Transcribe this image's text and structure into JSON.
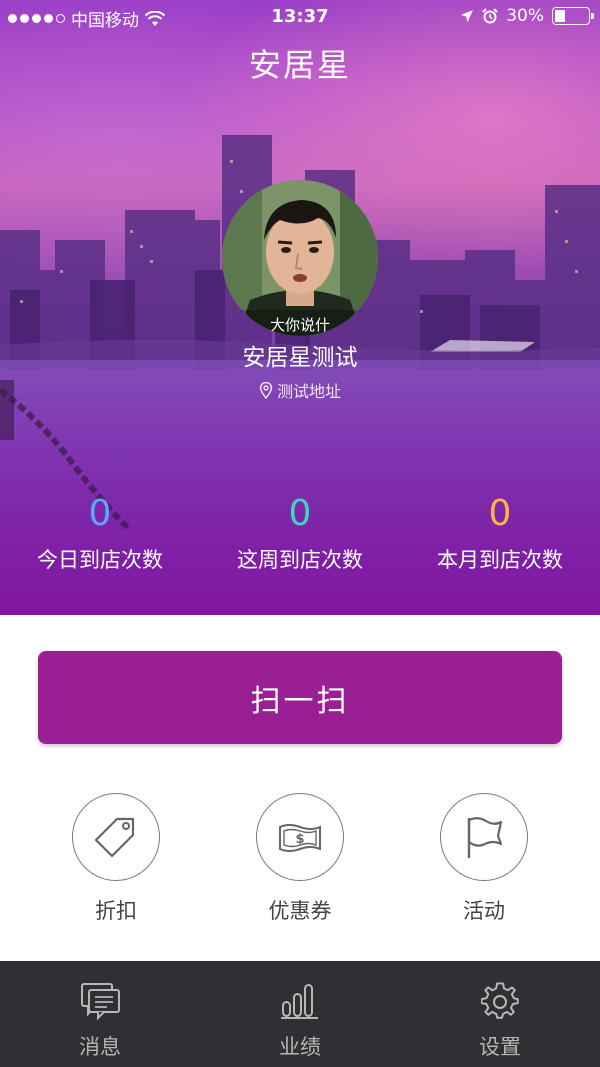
{
  "status_bar": {
    "carrier": "中国移动",
    "time": "13:37",
    "battery_percent": "30%",
    "battery_level": 0.3,
    "signal_bars_filled": 4,
    "signal_bars_total": 5
  },
  "header": {
    "title": "安居星"
  },
  "profile": {
    "avatar_caption": "大你说什",
    "store_name": "安居星测试",
    "address_icon": "location-pin-icon",
    "address": "测试地址"
  },
  "stats": [
    {
      "value": "0",
      "label": "今日到店次数",
      "color": "#5aa7ff"
    },
    {
      "value": "0",
      "label": "这周到店次数",
      "color": "#3fd6c1"
    },
    {
      "value": "0",
      "label": "本月到店次数",
      "color": "#ffb347"
    }
  ],
  "scan_button": {
    "label": "扫一扫",
    "color": "#9a1f94"
  },
  "actions": [
    {
      "label": "折扣",
      "icon": "price-tag-icon"
    },
    {
      "label": "优惠券",
      "icon": "coupon-cash-icon"
    },
    {
      "label": "活动",
      "icon": "flag-icon"
    }
  ],
  "tab_bar": [
    {
      "label": "消息",
      "icon": "message-icon"
    },
    {
      "label": "业绩",
      "icon": "bar-chart-icon"
    },
    {
      "label": "设置",
      "icon": "gear-icon"
    }
  ]
}
